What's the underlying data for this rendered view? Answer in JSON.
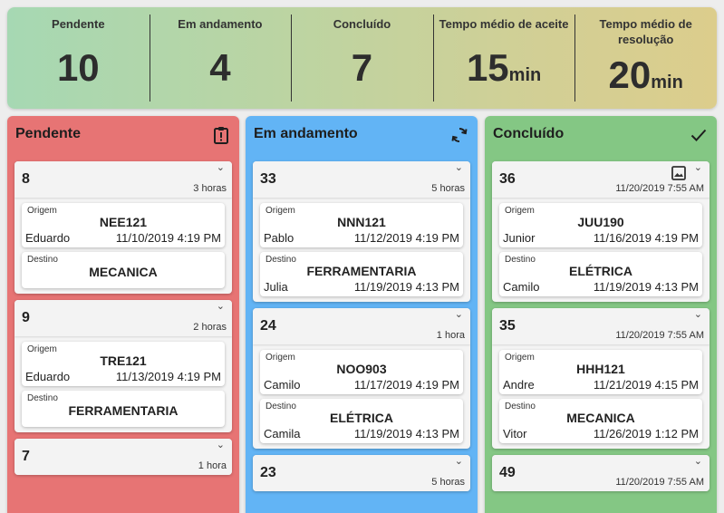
{
  "stats": [
    {
      "label": "Pendente",
      "value": "10",
      "unit": ""
    },
    {
      "label": "Em andamento",
      "value": "4",
      "unit": ""
    },
    {
      "label": "Concluído",
      "value": "7",
      "unit": ""
    },
    {
      "label": "Tempo médio de aceite",
      "value": "15",
      "unit": "min"
    },
    {
      "label": "Tempo médio de resolução",
      "value": "20",
      "unit": "min"
    }
  ],
  "columns": {
    "pendente": {
      "title": "Pendente",
      "icon": "clipboard-alert-icon",
      "color": "#e77474",
      "cards": [
        {
          "id": "8",
          "time": "3 horas",
          "origem": {
            "label": "Origem",
            "code": "NEE121",
            "person": "Eduardo",
            "date": "11/10/2019 4:19 PM"
          },
          "destino": {
            "label": "Destino",
            "code": "MECANICA"
          }
        },
        {
          "id": "9",
          "time": "2 horas",
          "origem": {
            "label": "Origem",
            "code": "TRE121",
            "person": "Eduardo",
            "date": "11/13/2019 4:19 PM"
          },
          "destino": {
            "label": "Destino",
            "code": "FERRAMENTARIA"
          }
        },
        {
          "id": "7",
          "time": "1 hora"
        }
      ]
    },
    "andamento": {
      "title": "Em andamento",
      "icon": "sync-icon",
      "color": "#62b4f5",
      "cards": [
        {
          "id": "33",
          "time": "5 horas",
          "origem": {
            "label": "Origem",
            "code": "NNN121",
            "person": "Pablo",
            "date": "11/12/2019 4:19 PM"
          },
          "destino": {
            "label": "Destino",
            "code": "FERRAMENTARIA",
            "person": "Julia",
            "date": "11/19/2019 4:13 PM"
          }
        },
        {
          "id": "24",
          "time": "1 hora",
          "origem": {
            "label": "Origem",
            "code": "NOO903",
            "person": "Camilo",
            "date": "11/17/2019 4:19 PM"
          },
          "destino": {
            "label": "Destino",
            "code": "ELÉTRICA",
            "person": "Camila",
            "date": "11/19/2019 4:13 PM"
          }
        },
        {
          "id": "23",
          "time": "5 horas"
        }
      ]
    },
    "concluido": {
      "title": "Concluído",
      "icon": "check-icon",
      "color": "#84c784",
      "cards": [
        {
          "id": "36",
          "time": "11/20/2019 7:55 AM",
          "origem": {
            "label": "Origem",
            "code": "JUU190",
            "person": "Junior",
            "date": "11/16/2019 4:19 PM"
          },
          "destino": {
            "label": "Destino",
            "code": "ELÉTRICA",
            "person": "Camilo",
            "date": "11/19/2019 4:13 PM"
          }
        },
        {
          "id": "35",
          "time": "11/20/2019 7:55 AM",
          "origem": {
            "label": "Origem",
            "code": "HHH121",
            "person": "Andre",
            "date": "11/21/2019 4:15 PM"
          },
          "destino": {
            "label": "Destino",
            "code": "MECANICA",
            "person": "Vitor",
            "date": "11/26/2019 1:12 PM"
          }
        },
        {
          "id": "49",
          "time": "11/20/2019 7:55 AM"
        }
      ]
    }
  },
  "icons": {
    "expand": "chevron-down-icon",
    "image": "image-icon"
  }
}
